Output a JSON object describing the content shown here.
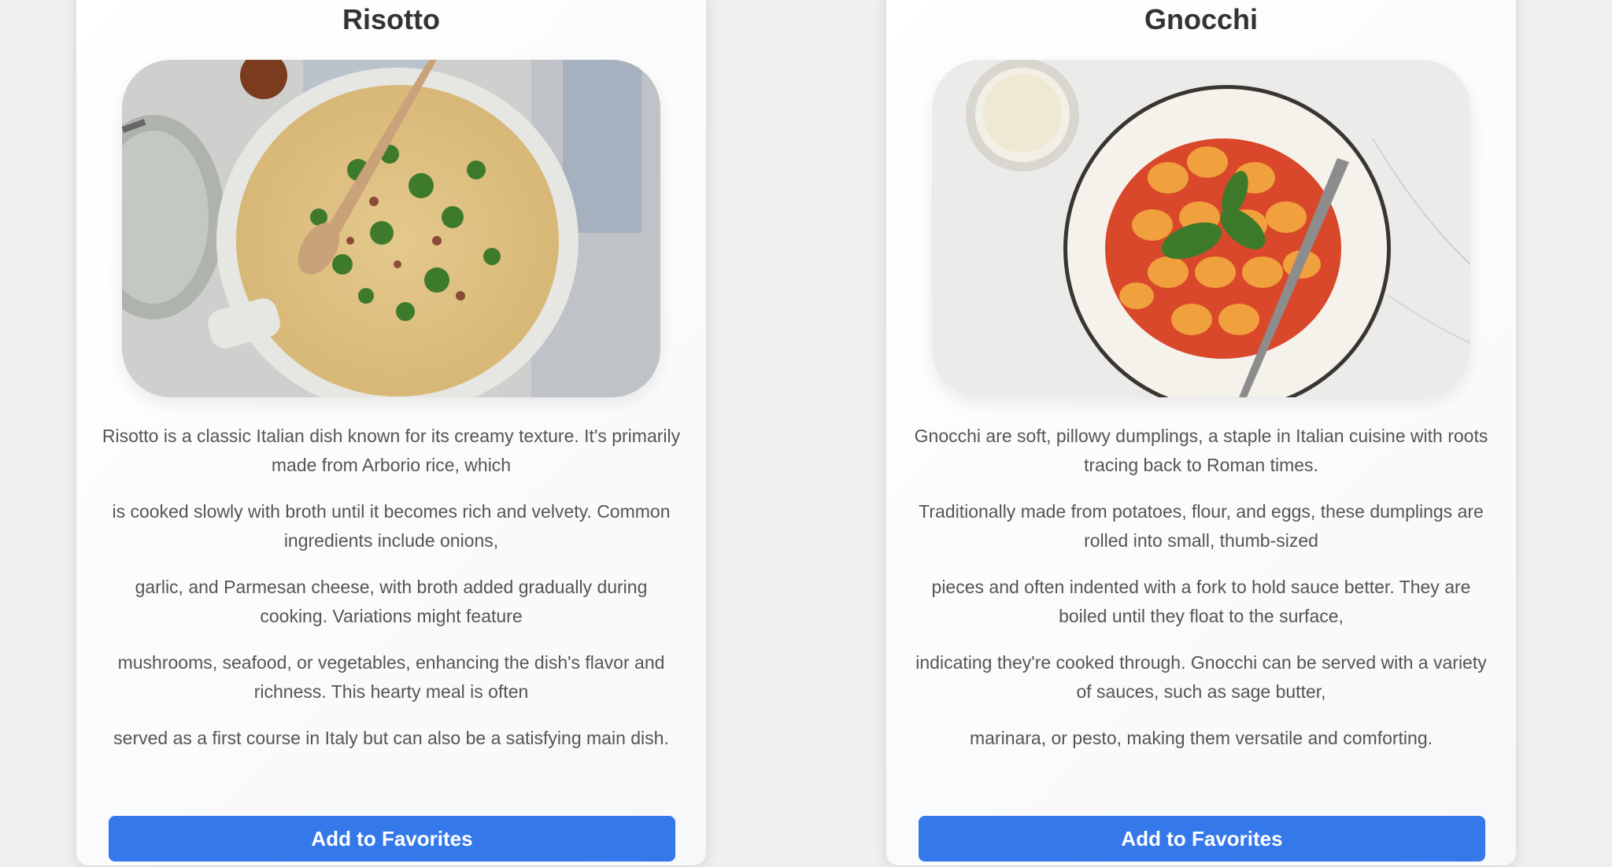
{
  "cards": [
    {
      "title": "Risotto",
      "image_icon": "risotto-photo",
      "paragraphs": [
        "Risotto is a classic Italian dish known for its creamy texture. It's primarily made from Arborio rice, which",
        "is cooked slowly with broth until it becomes rich and velvety. Common ingredients include onions,",
        "garlic, and Parmesan cheese, with broth added gradually during cooking. Variations might feature",
        "mushrooms, seafood, or vegetables, enhancing the dish's flavor and richness. This hearty meal is often",
        "served as a first course in Italy but can also be a satisfying main dish."
      ],
      "button_label": "Add to Favorites"
    },
    {
      "title": "Gnocchi",
      "image_icon": "gnocchi-photo",
      "paragraphs": [
        "Gnocchi are soft, pillowy dumplings, a staple in Italian cuisine with roots tracing back to Roman times.",
        "Traditionally made from potatoes, flour, and eggs, these dumplings are rolled into small, thumb-sized",
        "pieces and often indented with a fork to hold sauce better. They are boiled until they float to the surface,",
        "indicating they're cooked through. Gnocchi can be served with a variety of sauces, such as sage butter,",
        "marinara, or pesto, making them versatile and comforting."
      ],
      "button_label": "Add to Favorites"
    }
  ],
  "colors": {
    "page_background": "#f0f0f0",
    "card_background": "#ffffff",
    "button_background": "#3578ea",
    "button_text": "#ffffff",
    "title_text": "#333333",
    "body_text": "#555555"
  }
}
